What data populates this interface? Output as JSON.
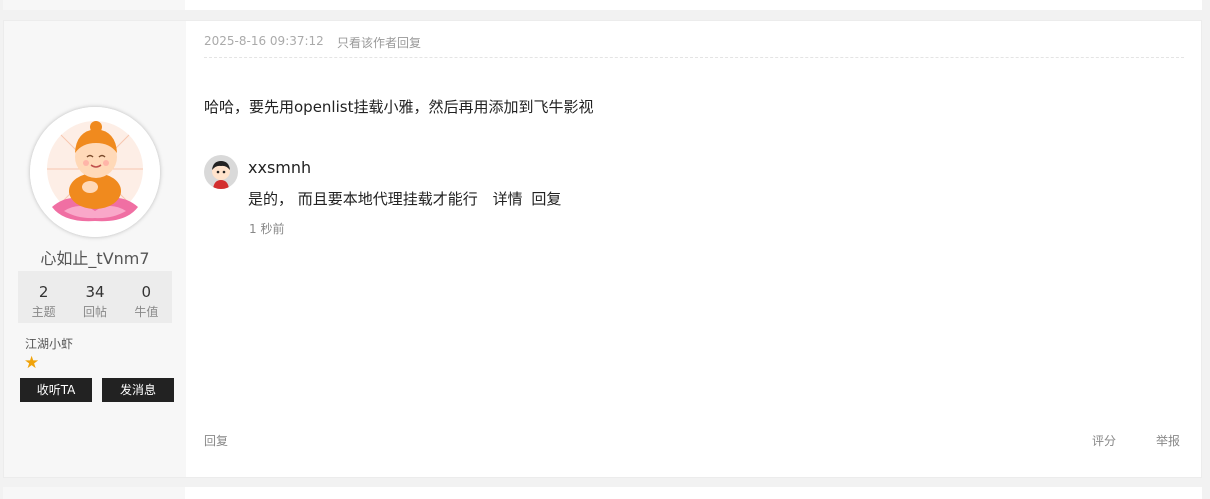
{
  "author": {
    "username": "心如止_tVnm7",
    "stats": [
      {
        "num": "2",
        "label": "主题"
      },
      {
        "num": "34",
        "label": "回帖"
      },
      {
        "num": "0",
        "label": "牛值"
      }
    ],
    "rank": "江湖小虾",
    "rank_icon": "star-icon",
    "follow_label": "收听TA",
    "message_label": "发消息"
  },
  "post": {
    "time": "2025-8-16 09:37:12",
    "only_author_label": "只看该作者回复",
    "body": "哈哈，要先用openlist挂载小雅，然后再用添加到飞牛影视",
    "comment": {
      "user": "xxsmnh",
      "text": "是的， 而且要本地代理挂载才能行",
      "detail_label": "详情",
      "reply_label": "回复",
      "time": "1 秒前"
    },
    "footer": {
      "reply_label": "回复",
      "rate_label": "评分",
      "report_label": "举报"
    }
  },
  "colors": {
    "button_bg": "#222222",
    "star": "#f0a30a",
    "sidebar_bg": "#f7f7f7"
  }
}
